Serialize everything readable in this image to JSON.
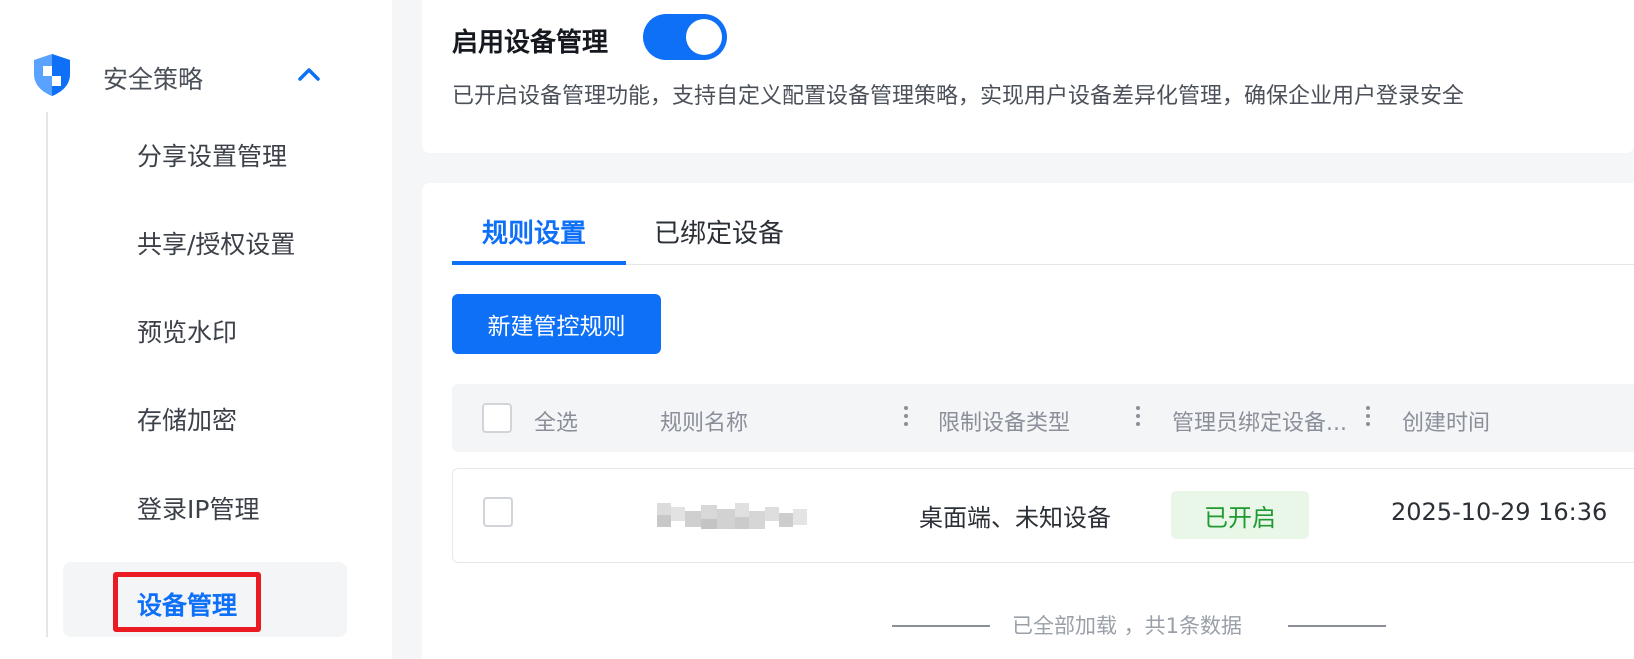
{
  "sidebar": {
    "group": {
      "label": "安全策略",
      "icon": "shield-icon",
      "expanded_icon": "chevron-up-icon"
    },
    "items": [
      {
        "label": "分享设置管理"
      },
      {
        "label": "共享/授权设置"
      },
      {
        "label": "预览水印"
      },
      {
        "label": "存储加密"
      },
      {
        "label": "登录IP管理"
      },
      {
        "label": "设备管理",
        "active": true
      }
    ]
  },
  "device_management": {
    "title": "启用设备管理",
    "enabled": true,
    "description": "已开启设备管理功能，支持自定义配置设备管理策略，实现用户设备差异化管理，确保企业用户登录安全"
  },
  "tabs": [
    {
      "label": "规则设置",
      "active": true
    },
    {
      "label": "已绑定设备",
      "active": false
    }
  ],
  "toolbar": {
    "new_rule_label": "新建管控规则"
  },
  "table": {
    "columns": {
      "select_all": "全选",
      "rule_name": "规则名称",
      "device_type": "限制设备类型",
      "admin_bind": "管理员绑定设备...",
      "created_at": "创建时间"
    },
    "rows": [
      {
        "rule_name": "",
        "device_type": "桌面端、未知设备",
        "status": "已开启",
        "created_at": "2025-10-29 16:36"
      }
    ],
    "footer": "已全部加载 ，共1条数据"
  },
  "colors": {
    "accent": "#0e6ff7",
    "status_green": "#1f9a32",
    "status_green_bg": "#e9f7e8",
    "highlight_red": "#ea1b23"
  }
}
